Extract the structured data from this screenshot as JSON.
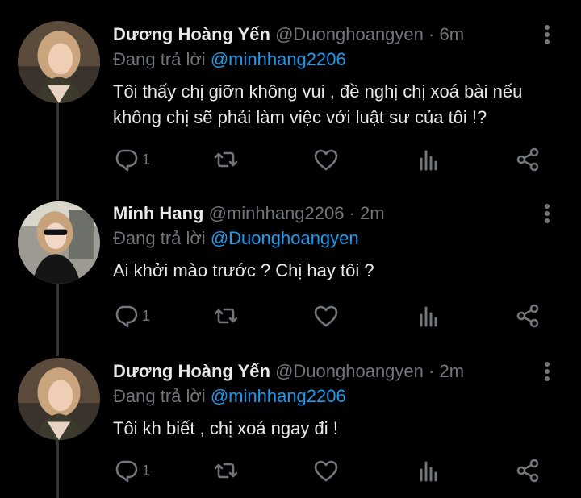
{
  "colors": {
    "background": "#000000",
    "text": "#e7e9ea",
    "secondary": "#71767b",
    "link": "#1d9bf0",
    "thread_line": "#333639"
  },
  "reply_prefix": "Đang trả lời",
  "tweets": [
    {
      "name": "Dương Hoàng Yến",
      "handle": "@Duonghoangyen",
      "separator": "·",
      "time": "6m",
      "reply_to": "@minhhang2206",
      "text_line1": "Tôi thấy chị giỡn không vui , đề nghị chị xoá bài nếu",
      "text_line2": "không chị sẽ phải làm việc với luật sư của tôi !?",
      "reply_count": "1",
      "avatar_icon": "profile-photo-icon"
    },
    {
      "name": "Minh Hang",
      "handle": "@minhhang2206",
      "separator": "·",
      "time": "2m",
      "reply_to": "@Duonghoangyen",
      "text_line1": "Ai khởi mào trước ? Chị hay tôi ?",
      "reply_count": "1",
      "avatar_icon": "profile-photo-icon"
    },
    {
      "name": "Dương Hoàng Yến",
      "handle": "@Duonghoangyen",
      "separator": "·",
      "time": "2m",
      "reply_to": "@minhhang2206",
      "text_line1": "Tôi kh biết , chị xoá ngay đi !",
      "reply_count": "1",
      "avatar_icon": "profile-photo-icon"
    }
  ],
  "action_icons": [
    "reply-icon",
    "retweet-icon",
    "like-icon",
    "analytics-icon",
    "share-icon"
  ]
}
